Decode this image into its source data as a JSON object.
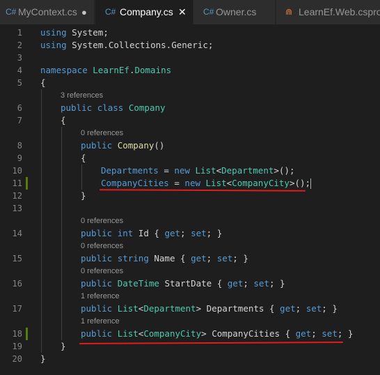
{
  "tabs": [
    {
      "icon": "C#",
      "label": "MyContext.cs",
      "dirty": "●"
    },
    {
      "icon": "C#",
      "label": "Company.cs",
      "close": "✕"
    },
    {
      "icon": "C#",
      "label": "Owner.cs"
    },
    {
      "icon": "⋒",
      "label": "LearnEf.Web.csproj"
    }
  ],
  "line_numbers": [
    "1",
    "2",
    "3",
    "4",
    "5",
    "6",
    "7",
    "8",
    "9",
    "10",
    "11",
    "12",
    "13",
    "14",
    "15",
    "16",
    "17",
    "18",
    "19",
    "20"
  ],
  "lens": {
    "class_refs": "3 references",
    "ctor_refs": "0 references",
    "id_refs": "0 references",
    "name_refs": "0 references",
    "start_refs": "0 references",
    "dept_refs": "1 reference",
    "cities_refs": "1 reference"
  },
  "code": {
    "l1": {
      "using": "using",
      "ns": "System",
      "semi": ";"
    },
    "l2": {
      "using": "using",
      "ns1": "System",
      "dot1": ".",
      "ns2": "Collections",
      "dot2": ".",
      "ns3": "Generic",
      "semi": ";"
    },
    "l4": {
      "kw": "namespace",
      "ns1": "LearnEf",
      "dot": ".",
      "ns2": "Domains"
    },
    "l5": "{",
    "l6": {
      "public": "public",
      "class": "class",
      "name": "Company"
    },
    "l7": "{",
    "l8": {
      "public": "public",
      "name": "Company",
      "parens": "()"
    },
    "l9": "{",
    "l10": {
      "prop": "Departments",
      "eq": " = ",
      "new": "new",
      "list": "List",
      "lt": "<",
      "type": "Department",
      "tail": ">();"
    },
    "l11": {
      "prop": "CompanyCities",
      "eq": " = ",
      "new": "new",
      "list": "List",
      "lt": "<",
      "type": "CompanyCity",
      "tail": ">();"
    },
    "l12": "}",
    "l14": {
      "public": "public",
      "type": "int",
      "name": "Id",
      "ob": "{ ",
      "get": "get",
      "sep": "; ",
      "set": "set",
      "cb": "; }"
    },
    "l15": {
      "public": "public",
      "type": "string",
      "name": "Name",
      "ob": "{ ",
      "get": "get",
      "sep": "; ",
      "set": "set",
      "cb": "; }"
    },
    "l16": {
      "public": "public",
      "type": "DateTime",
      "name": "StartDate",
      "ob": "{ ",
      "get": "get",
      "sep": "; ",
      "set": "set",
      "cb": "; }"
    },
    "l17": {
      "public": "public",
      "list": "List",
      "lt": "<",
      "type": "Department",
      "gt": ">",
      "name": "Departments",
      "ob": "{ ",
      "get": "get",
      "sep": "; ",
      "set": "set",
      "cb": "; }"
    },
    "l18": {
      "public": "public",
      "list": "List",
      "lt": "<",
      "type": "CompanyCity",
      "gt": ">",
      "name": "CompanyCities",
      "ob": "{ ",
      "get": "get",
      "sep": "; ",
      "set": "set",
      "cb": "; }"
    },
    "l19": "}",
    "l20": "}"
  },
  "colors": {
    "keyword": "#569cd6",
    "type": "#4ec9b0",
    "method": "#dcdcaa",
    "annotation": "#e31b1b",
    "modified_gutter": "#587c0c"
  }
}
